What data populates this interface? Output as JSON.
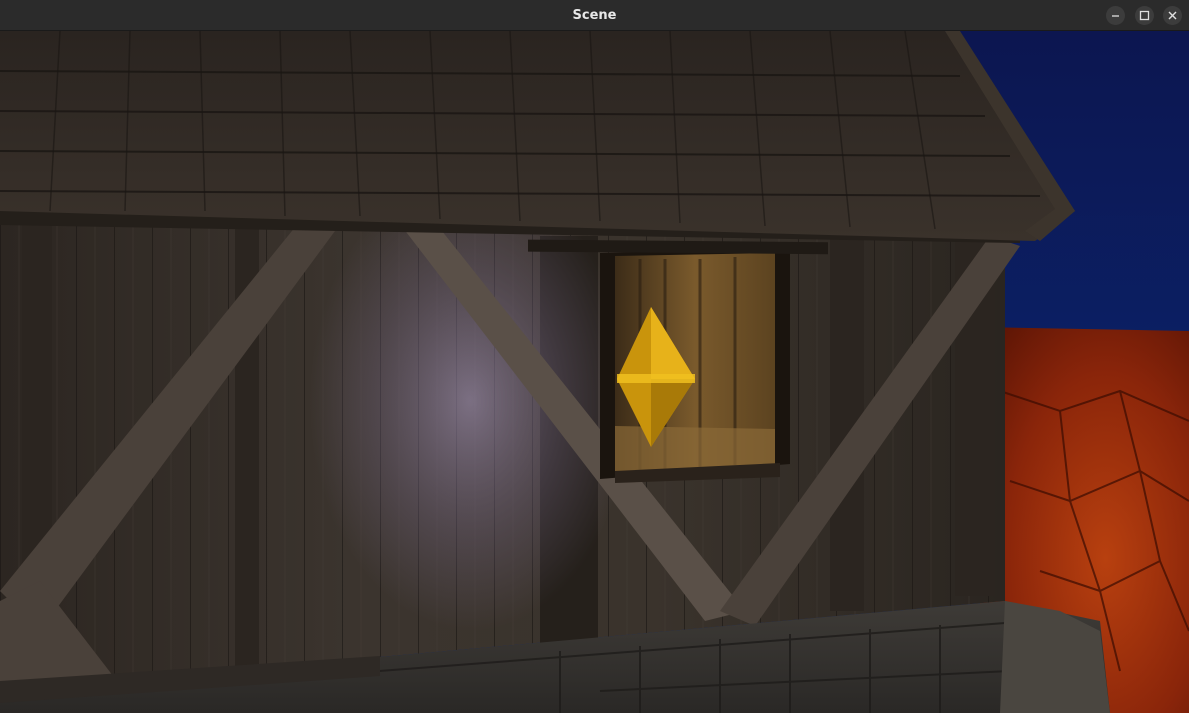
{
  "window": {
    "title": "Scene",
    "controls": {
      "minimize_icon": "minimize-icon",
      "maximize_icon": "maximize-icon",
      "close_icon": "close-icon"
    }
  },
  "scene": {
    "sky_color": "#0a1a5c",
    "ground_color": "#a8300f",
    "wood_color": "#3e3630",
    "roof_color": "#2e2822",
    "stone_color": "#3a3734",
    "window_glow_color": "#7a5a26",
    "gem_color": "#e0a80c",
    "light_color": "#a89ab8"
  }
}
